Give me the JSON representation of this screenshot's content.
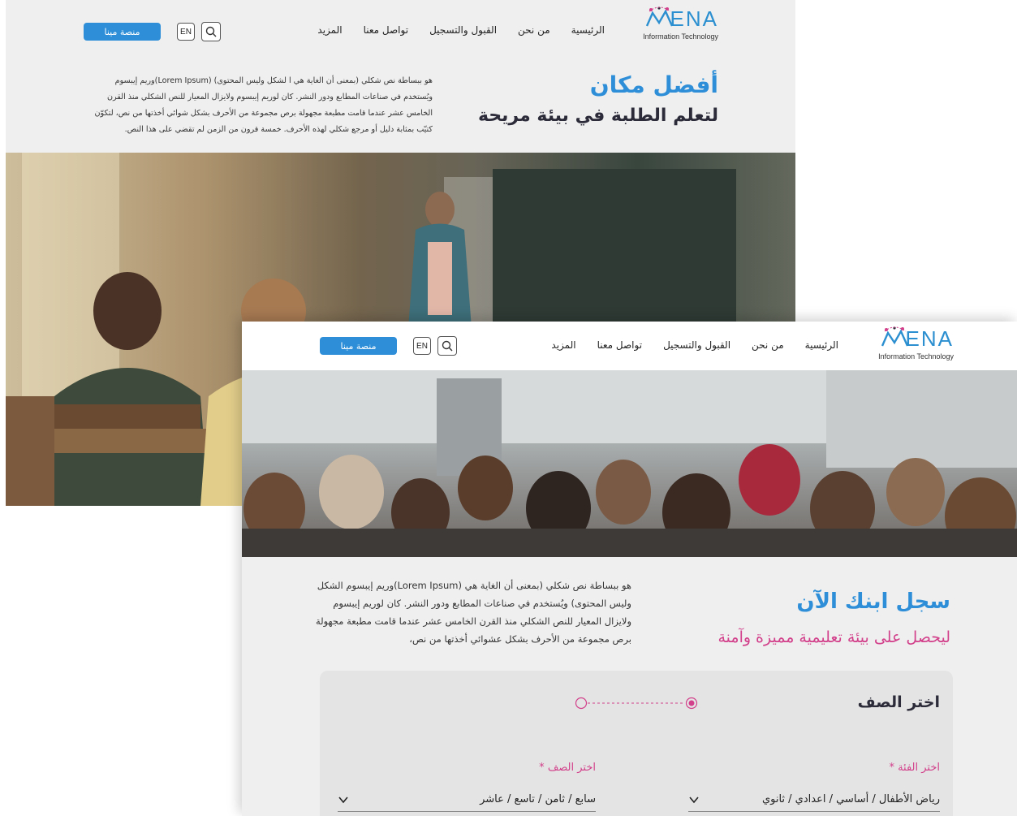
{
  "brand": {
    "name": "ENA",
    "tagline": "Information Technology"
  },
  "nav": {
    "items": [
      "الرئيسية",
      "من نحن",
      "القبول والتسجيل",
      "تواصل معنا",
      "المزيد"
    ],
    "lang_label": "EN",
    "platform_button": "منصة مينا"
  },
  "back_page": {
    "title_line1": "أفضل مكان",
    "title_line2": "لتعلم الطلبة في بيئة مريحة",
    "paragraph": "هو ببساطة نص شكلي (بمعنى  أن  الغاية  هي ا لشكل  وليس  المحتوى) (Lorem Ipsum)وريم إيبسوم ويُستخدم  في صناعات المطابع ودور النشر. كان لوريم إيبسوم ولايزال المعيار للنص الشكلي منذ القرن الخامس عشر عندما قامت مطبعة مجهولة برص مجموعة من الأحرف بشكل شوائي أخذتها من نص، لتكوّن كتيّب بمثابة دليل أو مرجع شكلي لهذه الأحرف. خمسة قرون من الزمن لم تقضي على هذا النص."
  },
  "front_page": {
    "title": "سجل ابنك الآن",
    "subtitle": "ليحصل على بيئة تعليمية مميزة وآمنة",
    "paragraph": "هو ببساطة نص شكلي (بمعنى أن الغاية هي (Lorem Ipsum)وريم إيبسوم الشكل وليس المحتوى) ويُستخدم في صناعات المطابع ودور النشر. كان لوريم إيبسوم ولايزال المعيار للنص الشكلي منذ القرن الخامس عشر عندما قامت مطبعة مجهولة برص مجموعة من الأحرف بشكل عشوائي أخذتها من نص،",
    "form": {
      "title": "اختر الصف",
      "category_label": "اختر الفئة",
      "category_value": "رياض الأطفال / أساسي / اعدادي / ثانوي",
      "grade_label": "اختر الصف",
      "grade_value": "سابع / ثامن / تاسع / عاشر",
      "required_mark": "*"
    }
  },
  "colors": {
    "accent_blue": "#2e8fd8",
    "accent_pink": "#d23f8a",
    "dark_navy": "#2b2b3a",
    "page_bg": "#efefef"
  },
  "icons": [
    "search-icon",
    "chevron-down-icon",
    "logo-mark-icon",
    "step-indicator-icon"
  ]
}
